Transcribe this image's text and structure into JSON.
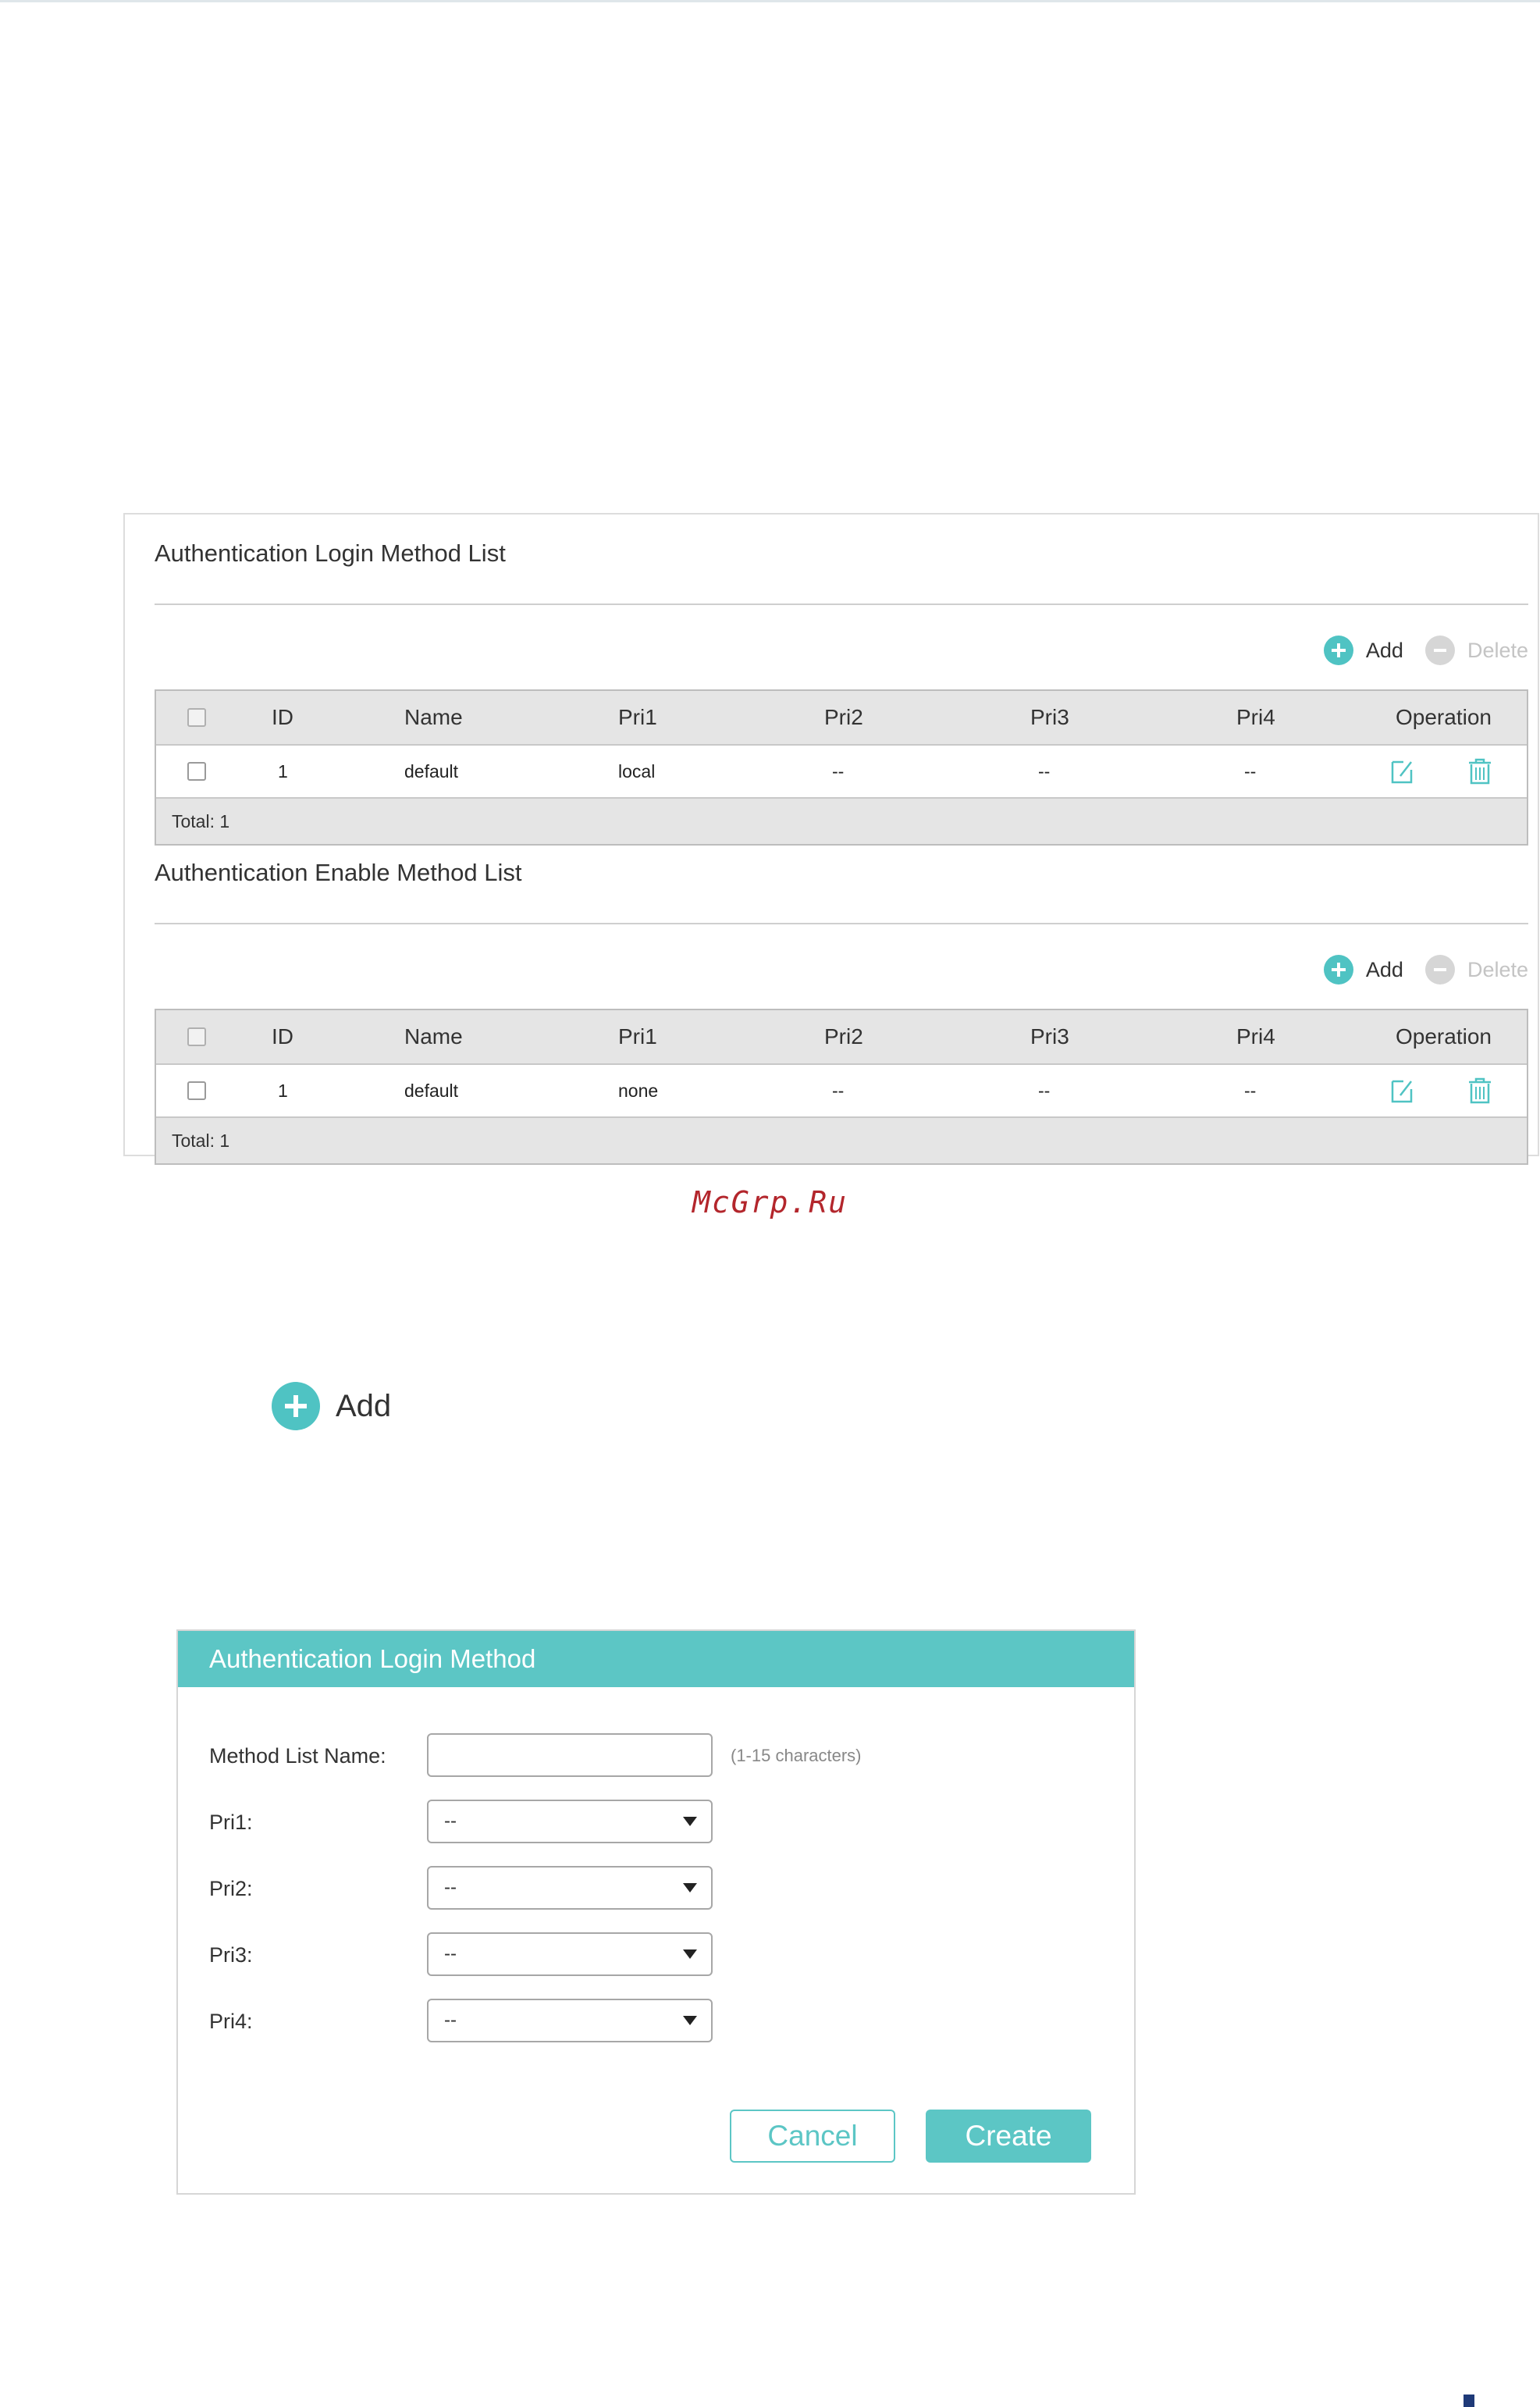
{
  "login_list": {
    "title": "Authentication Login Method List",
    "add_label": "Add",
    "delete_label": "Delete",
    "columns": [
      "ID",
      "Name",
      "Pri1",
      "Pri2",
      "Pri3",
      "Pri4",
      "Operation"
    ],
    "rows": [
      {
        "id": "1",
        "name": "default",
        "pri1": "local",
        "pri2": "--",
        "pri3": "--",
        "pri4": "--"
      }
    ],
    "total": "Total: 1"
  },
  "enable_list": {
    "title": "Authentication Enable Method List",
    "add_label": "Add",
    "delete_label": "Delete",
    "columns": [
      "ID",
      "Name",
      "Pri1",
      "Pri2",
      "Pri3",
      "Pri4",
      "Operation"
    ],
    "rows": [
      {
        "id": "1",
        "name": "default",
        "pri1": "none",
        "pri2": "--",
        "pri3": "--",
        "pri4": "--"
      }
    ],
    "total": "Total: 1"
  },
  "watermark": "McGrp.Ru",
  "standalone_add": {
    "label": "Add"
  },
  "dialog": {
    "title": "Authentication Login Method",
    "method_list_name_label": "Method List Name:",
    "method_list_name_value": "",
    "method_list_name_hint": "(1-15 characters)",
    "pri1_label": "Pri1:",
    "pri1_value": "--",
    "pri2_label": "Pri2:",
    "pri2_value": "--",
    "pri3_label": "Pri3:",
    "pri3_value": "--",
    "pri4_label": "Pri4:",
    "pri4_value": "--",
    "cancel_label": "Cancel",
    "create_label": "Create"
  },
  "colors": {
    "accent": "#5cc6c5",
    "disabled": "#d6d6d6",
    "header_bg": "#e5e5e5",
    "watermark": "#b3262c"
  },
  "icons": [
    "plus-circle-icon",
    "minus-circle-icon",
    "edit-icon",
    "trash-icon",
    "chevron-down-icon"
  ]
}
